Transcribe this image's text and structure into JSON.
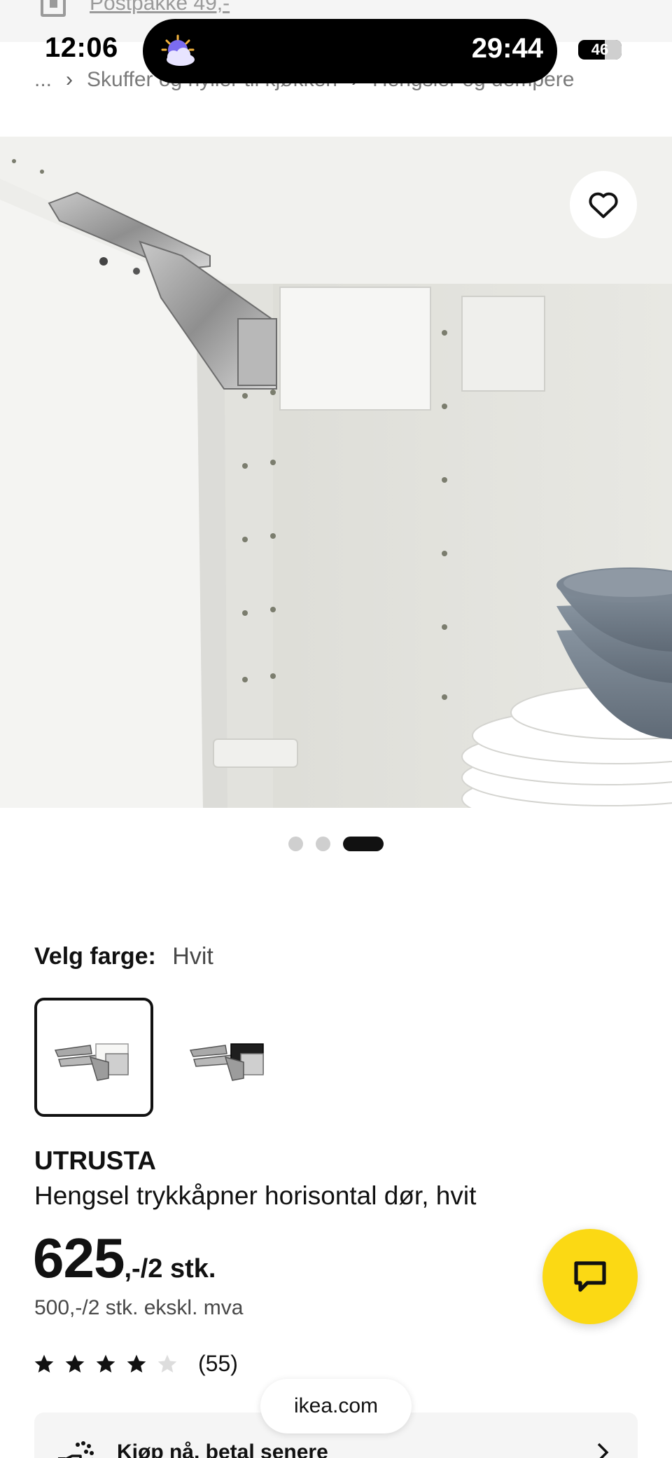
{
  "status_bar": {
    "time": "12:06",
    "timer": "29:44",
    "battery": "46",
    "weather_icon": "cloud-moon-icon"
  },
  "banner": {
    "link_text": "Postpakke 49,-",
    "icon": "package-icon"
  },
  "breadcrumb": {
    "items": [
      "...",
      "Skuffer og hyller til kjøkken",
      "Hengsler og dempere"
    ],
    "separator_icon": "chevron-right-icon"
  },
  "gallery": {
    "image_count": 3,
    "active_index": 2
  },
  "product": {
    "color_label": "Velg farge:",
    "color_value": "Hvit",
    "swatches": [
      "Hvit",
      "Svart"
    ],
    "brand": "UTRUSTA",
    "description": "Hengsel trykkåpner horisontal dør, hvit",
    "price_integer": "625",
    "price_suffix": ",-/2 stk.",
    "price_excl_vat": "500,-/2 stk. ekskl. mva",
    "rating": 4,
    "rating_max": 5,
    "review_count": "(55)"
  },
  "browser": {
    "url": "ikea.com"
  },
  "pay_later": {
    "label": "Kjøp nå, betal senere"
  },
  "colors": {
    "chat_button": "#fbd914",
    "star_filled": "#111111",
    "star_empty": "#dddddd"
  }
}
